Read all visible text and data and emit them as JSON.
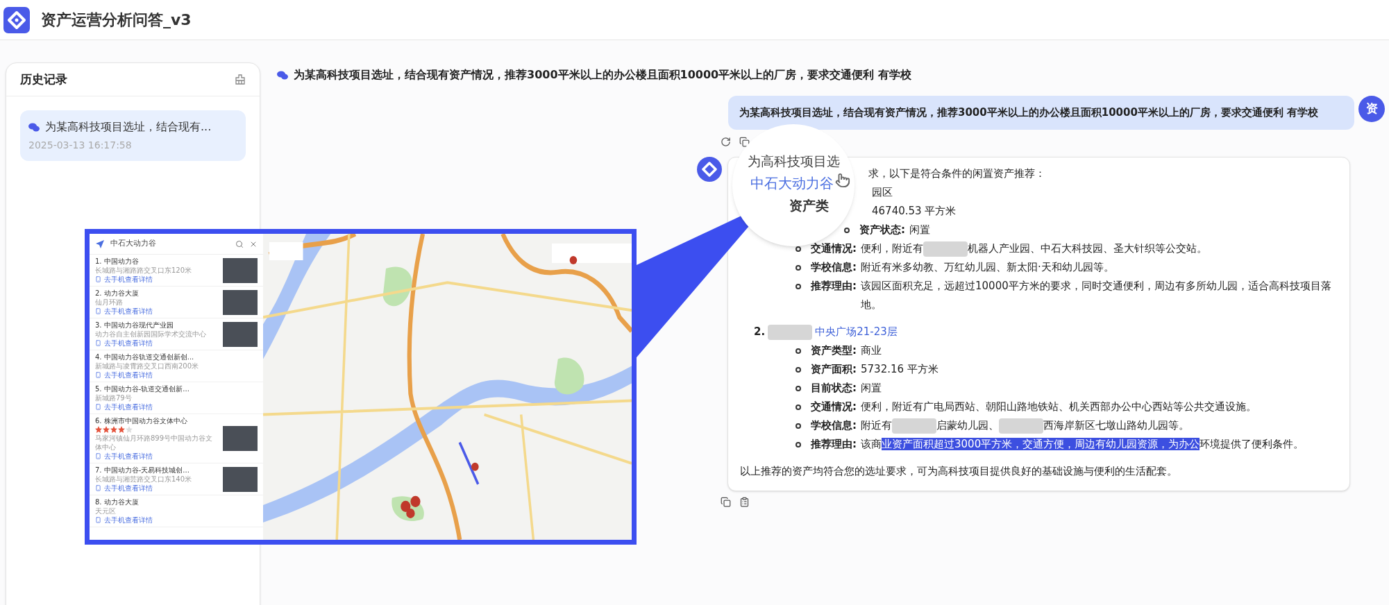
{
  "app": {
    "title": "资产运营分析问答_v3"
  },
  "history": {
    "title": "历史记录",
    "items": [
      {
        "text": "为某高科技项目选址，结合现有...",
        "time": "2025-03-13 16:17:58",
        "selected": true
      }
    ]
  },
  "conversation": {
    "topic": "为某高科技项目选址，结合现有资产情况，推荐3000平米以上的办公楼且面积10000平米以上的厂房，要求交通便利 有学校",
    "user": {
      "avatar": "资",
      "text": "为某高科技项目选址，结合现有资产情况，推荐3000平米以上的办公楼且面积10000平米以上的厂房，要求交通便利 有学校"
    },
    "answer": {
      "lens": [
        {
          "kind": "text",
          "text": "为高科技项目选"
        },
        {
          "kind": "link",
          "text": "中石大动力谷"
        },
        {
          "kind": "label",
          "text": "资产类"
        }
      ],
      "intro": "求，以下是符合条件的闲置资产推荐：",
      "items": [
        {
          "fields": [
            {
              "value": [
                {
                  "kind": "text",
                  "text": "园区"
                }
              ]
            },
            {
              "value": [
                {
                  "kind": "text",
                  "text": "46740.53 平方米"
                }
              ]
            },
            {
              "label": "资产状态:",
              "value": [
                {
                  "kind": "text",
                  "text": "闲置"
                }
              ]
            },
            {
              "label": "交通情况:",
              "value": [
                {
                  "kind": "text",
                  "text": "便利，附近有"
                },
                {
                  "kind": "redacted"
                },
                {
                  "kind": "text",
                  "text": "机器人产业园、中石大科技园、圣大针织等公交站。"
                }
              ]
            },
            {
              "label": "学校信息:",
              "value": [
                {
                  "kind": "text",
                  "text": "附近有米多幼教、万红幼儿园、新太阳·天和幼儿园等。"
                }
              ]
            },
            {
              "label": "推荐理由:",
              "value": [
                {
                  "kind": "text",
                  "text": "该园区面积充足，远超过10000平方米的要求，同时交通便利，周边有多所幼儿园，适合高科技项目落地。"
                }
              ]
            }
          ]
        },
        {
          "number": "2.",
          "title": [
            {
              "kind": "redacted"
            },
            {
              "kind": "text",
              "text": "中央广场21-23层"
            }
          ],
          "fields": [
            {
              "label": "资产类型:",
              "value": [
                {
                  "kind": "text",
                  "text": "商业"
                }
              ]
            },
            {
              "label": "资产面积:",
              "value": [
                {
                  "kind": "text",
                  "text": "5732.16 平方米"
                }
              ]
            },
            {
              "label": "目前状态:",
              "value": [
                {
                  "kind": "text",
                  "text": "闲置"
                }
              ]
            },
            {
              "label": "交通情况:",
              "value": [
                {
                  "kind": "text",
                  "text": "便利，附近有广电局西站、朝阳山路地铁站、机关西部办公中心西站等公共交通设施。"
                }
              ]
            },
            {
              "label": "学校信息:",
              "value": [
                {
                  "kind": "text",
                  "text": "附近有"
                },
                {
                  "kind": "redacted"
                },
                {
                  "kind": "text",
                  "text": "启蒙幼儿园、"
                },
                {
                  "kind": "redacted"
                },
                {
                  "kind": "text",
                  "text": "西海岸新区七墩山路幼儿园等。"
                }
              ]
            },
            {
              "label": "推荐理由:",
              "value": [
                {
                  "kind": "text",
                  "text": "该商"
                },
                {
                  "kind": "highlight",
                  "text": "业资产面积超过3000平方米，交通方便，周边有幼儿园资源，为办公"
                },
                {
                  "kind": "text",
                  "text": "环境提供了便利条件。"
                }
              ]
            }
          ]
        }
      ],
      "closing": "以上推荐的资产均符合您的选址要求，可为高科技项目提供良好的基础设施与便利的生活配套。"
    }
  },
  "map_inset": {
    "search": "中石大动力谷",
    "results": [
      {
        "title": "1. 中国动力谷",
        "address": "长城路与湘路路交叉口东120米",
        "link": "去手机查看详情",
        "photo": true
      },
      {
        "title": "2. 动力谷大厦",
        "address": "仙月环路",
        "link": "去手机查看详情",
        "photo": true
      },
      {
        "title": "3. 中国动力谷现代产业园",
        "address": "动力谷自主创新园国际学术交流中心",
        "link": "去手机查看详情",
        "photo": true
      },
      {
        "title": "4. 中国动力谷轨道交通创新创...",
        "address": "新城路与凌霄路交叉口西南200米",
        "link": "去手机查看详情",
        "photo": false
      },
      {
        "title": "5. 中国动力谷-轨道交通创新...",
        "address": "新城路79号",
        "link": "去手机查看详情",
        "photo": false
      },
      {
        "title": "6. 株洲市中国动力谷文体中心",
        "stars": 4,
        "address": "马家河镇仙月环路899号中国动力谷文体中心",
        "link": "去手机查看详情",
        "photo": true
      },
      {
        "title": "7. 中国动力谷-天易科技城创...",
        "address": "长城路与湘芸路交叉口东140米",
        "link": "去手机查看详情",
        "photo": true
      },
      {
        "title": "8. 动力谷大厦",
        "address": "天元区",
        "link": "去手机查看详情",
        "photo": false
      }
    ]
  }
}
